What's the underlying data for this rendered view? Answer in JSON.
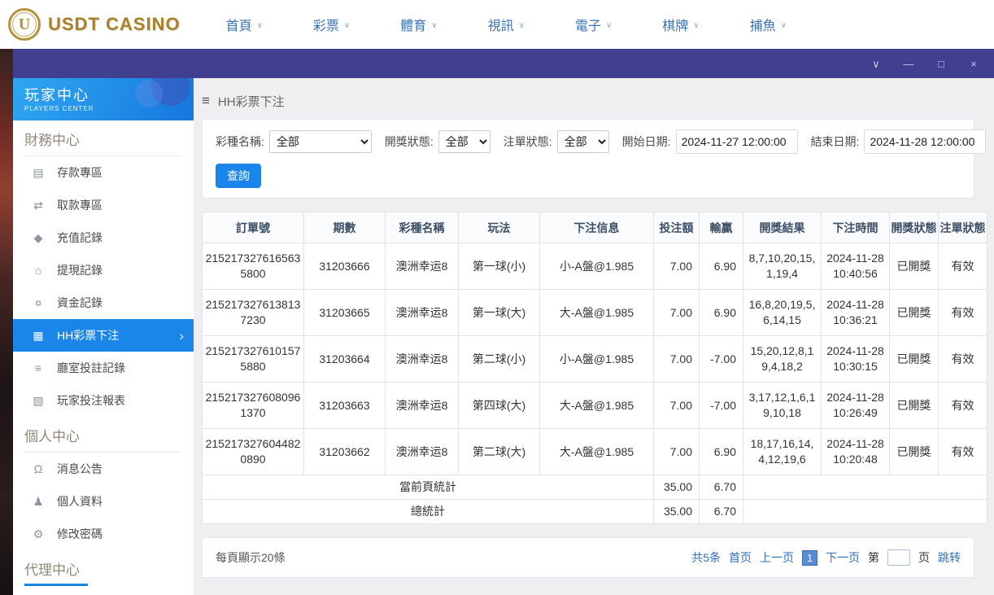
{
  "topbar": {
    "logo": {
      "text": "USDT CASINO",
      "emblem_letter": "U"
    },
    "chevron_glyph": "∨",
    "nav": [
      {
        "label": "首頁"
      },
      {
        "label": "彩票"
      },
      {
        "label": "體育"
      },
      {
        "label": "視訊"
      },
      {
        "label": "電子"
      },
      {
        "label": "棋牌"
      },
      {
        "label": "捕魚"
      }
    ]
  },
  "titlebar": {
    "controls": {
      "collapse": "∨",
      "minimize": "—",
      "maximize": "□",
      "close": "×"
    }
  },
  "sidebar": {
    "title": "玩家中心",
    "subtitle": "PLAYERS CENTER",
    "sections": [
      {
        "title": "財務中心",
        "items": [
          {
            "label": "存款專區",
            "icon": "deposit-icon",
            "glyph": "▤"
          },
          {
            "label": "取款專區",
            "icon": "withdraw-icon",
            "glyph": "⇄"
          },
          {
            "label": "充值記錄",
            "icon": "recharge-records-icon",
            "glyph": "◆"
          },
          {
            "label": "提現記錄",
            "icon": "withdrawal-records-icon",
            "glyph": "⌂"
          },
          {
            "label": "資金記錄",
            "icon": "funds-records-icon",
            "glyph": "¤"
          },
          {
            "label": "HH彩票下注",
            "icon": "lottery-ticket-icon",
            "glyph": "▦",
            "arrow": "›"
          },
          {
            "label": "廳室投註記錄",
            "icon": "room-records-icon",
            "glyph": "≡"
          },
          {
            "label": "玩家投注報表",
            "icon": "report-icon",
            "glyph": "▧"
          }
        ]
      },
      {
        "title": "個人中心",
        "items": [
          {
            "label": "消息公告",
            "icon": "bell-icon",
            "glyph": "Ω"
          },
          {
            "label": "個人資料",
            "icon": "user-icon",
            "glyph": "♟"
          },
          {
            "label": "修改密碼",
            "icon": "gear-icon",
            "glyph": "⚙"
          }
        ]
      },
      {
        "title": "代理中心",
        "items": []
      }
    ]
  },
  "main": {
    "breadcrumb": {
      "icon": "≡",
      "label": "HH彩票下注"
    },
    "filters": {
      "lottery": {
        "label": "彩種名稱:",
        "value": "全部"
      },
      "draw_status": {
        "label": "開獎狀態:",
        "value": "全部"
      },
      "order_status": {
        "label": "注單狀態:",
        "value": "全部"
      },
      "start_date": {
        "label": "開始日期:",
        "value": "2024-11-27 12:00:00"
      },
      "end_date": {
        "label": "結束日期:",
        "value": "2024-11-28 12:00:00"
      },
      "search_label": "查詢"
    },
    "table": {
      "headers": [
        "訂單號",
        "期數",
        "彩種名稱",
        "玩法",
        "下注信息",
        "投注額",
        "輸贏",
        "開獎結果",
        "下注時間",
        "開獎狀態",
        "注單狀態"
      ],
      "rows": [
        {
          "order": "2152173276165635800",
          "period": "31203666",
          "lottery": "澳洲幸运8",
          "play": "第一球(小)",
          "info": "小-A盤@1.985",
          "bet": "7.00",
          "win": "6.90",
          "result": "8,7,10,20,15,1,19,4",
          "time": "2024-11-28 10:40:56",
          "draw": "已開獎",
          "status": "有效"
        },
        {
          "order": "2152173276138137230",
          "period": "31203665",
          "lottery": "澳洲幸运8",
          "play": "第一球(大)",
          "info": "大-A盤@1.985",
          "bet": "7.00",
          "win": "6.90",
          "result": "16,8,20,19,5,6,14,15",
          "time": "2024-11-28 10:36:21",
          "draw": "已開獎",
          "status": "有效"
        },
        {
          "order": "2152173276101575880",
          "period": "31203664",
          "lottery": "澳洲幸运8",
          "play": "第二球(小)",
          "info": "小-A盤@1.985",
          "bet": "7.00",
          "win": "-7.00",
          "result": "15,20,12,8,19,4,18,2",
          "time": "2024-11-28 10:30:15",
          "draw": "已開獎",
          "status": "有效"
        },
        {
          "order": "2152173276080961370",
          "period": "31203663",
          "lottery": "澳洲幸运8",
          "play": "第四球(大)",
          "info": "大-A盤@1.985",
          "bet": "7.00",
          "win": "-7.00",
          "result": "3,17,12,1,6,19,10,18",
          "time": "2024-11-28 10:26:49",
          "draw": "已開獎",
          "status": "有效"
        },
        {
          "order": "2152173276044820890",
          "period": "31203662",
          "lottery": "澳洲幸运8",
          "play": "第二球(大)",
          "info": "大-A盤@1.985",
          "bet": "7.00",
          "win": "6.90",
          "result": "18,17,16,14,4,12,19,6",
          "time": "2024-11-28 10:20:48",
          "draw": "已開獎",
          "status": "有效"
        }
      ],
      "summary": [
        {
          "label": "當前頁統計",
          "bet": "35.00",
          "win": "6.70"
        },
        {
          "label": "總統計",
          "bet": "35.00",
          "win": "6.70"
        }
      ]
    },
    "pagination": {
      "page_size_text": "每頁顯示20條",
      "total_text": "共5条",
      "first": "首页",
      "prev": "上一页",
      "current": "1",
      "next": "下一页",
      "label_before_input": "第",
      "label_after_input": "页",
      "jump": "跳转"
    }
  }
}
